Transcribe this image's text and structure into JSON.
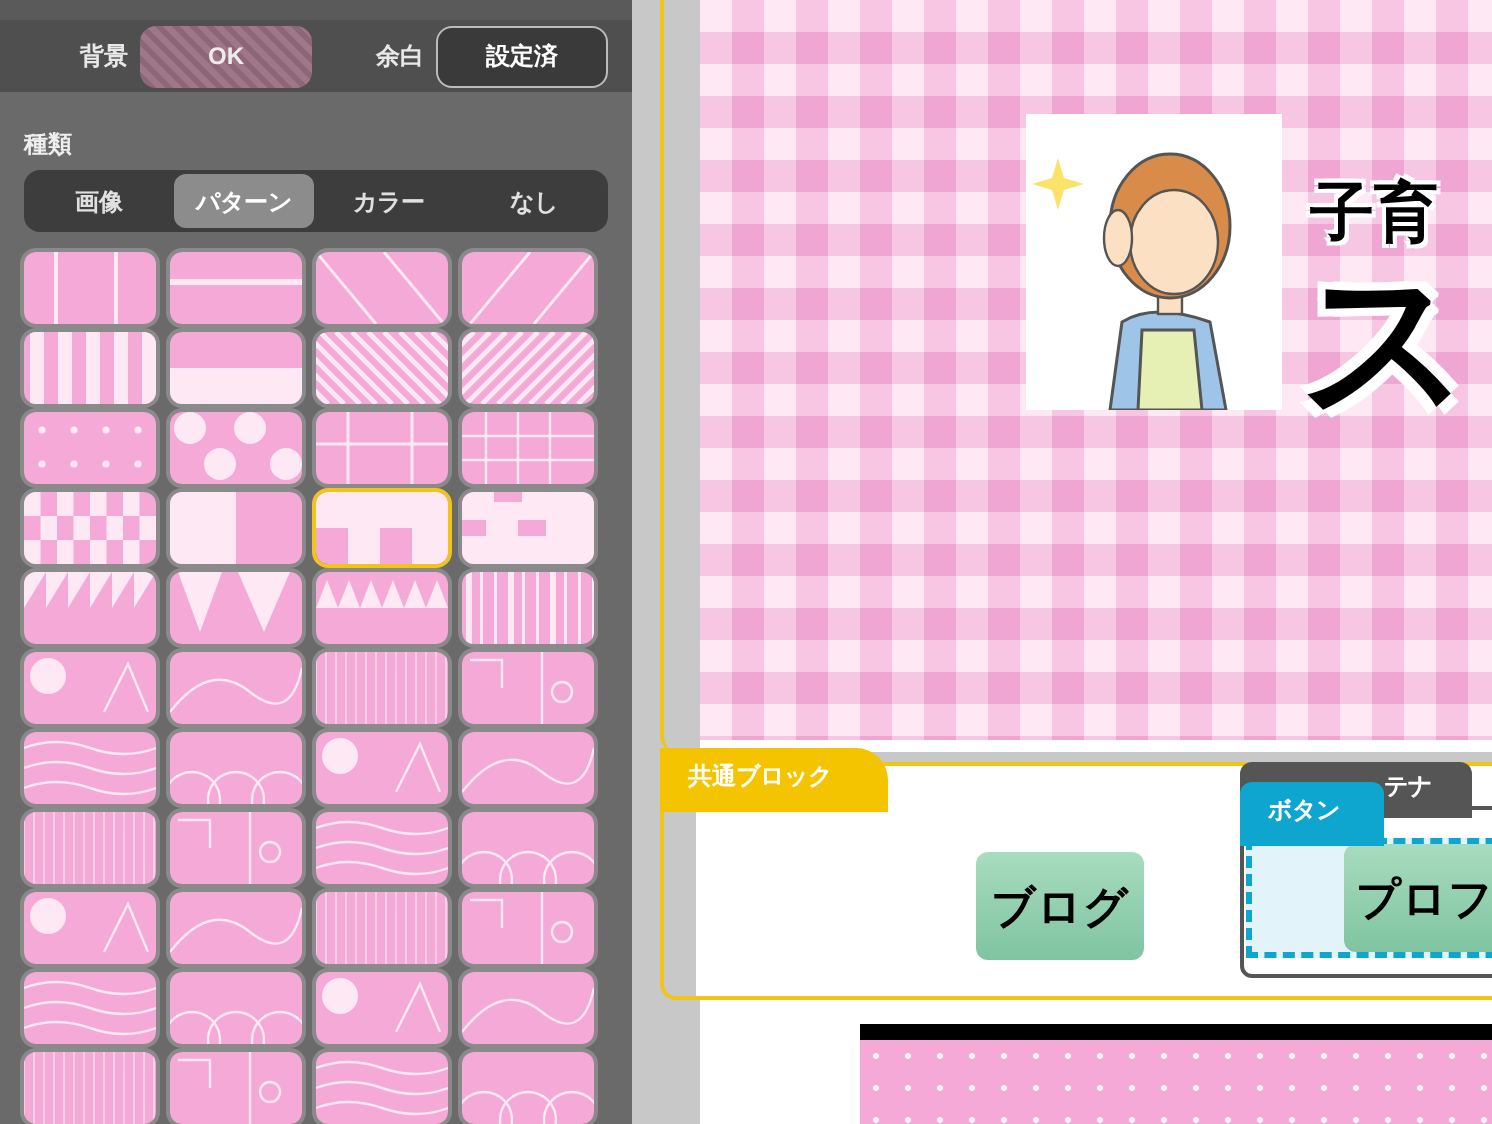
{
  "panel": {
    "background_label": "背景",
    "background_button": "OK",
    "margin_label": "余白",
    "margin_button": "設定済",
    "type_label": "種類",
    "type_tabs": [
      {
        "label": "画像",
        "selected": false
      },
      {
        "label": "パターン",
        "selected": true
      },
      {
        "label": "カラー",
        "selected": false
      },
      {
        "label": "なし",
        "selected": false
      }
    ],
    "patterns": [
      {
        "selected": false
      },
      {
        "selected": false
      },
      {
        "selected": false
      },
      {
        "selected": false
      },
      {
        "selected": false
      },
      {
        "selected": false
      },
      {
        "selected": false
      },
      {
        "selected": false
      },
      {
        "selected": false
      },
      {
        "selected": false
      },
      {
        "selected": false
      },
      {
        "selected": false
      },
      {
        "selected": false
      },
      {
        "selected": false
      },
      {
        "selected": true
      },
      {
        "selected": false
      },
      {
        "selected": false
      },
      {
        "selected": false
      },
      {
        "selected": false
      },
      {
        "selected": false
      },
      {
        "selected": false
      },
      {
        "selected": false
      },
      {
        "selected": false
      },
      {
        "selected": false
      },
      {
        "selected": false
      },
      {
        "selected": false
      },
      {
        "selected": false
      },
      {
        "selected": false
      },
      {
        "selected": false
      },
      {
        "selected": false
      },
      {
        "selected": false
      },
      {
        "selected": false
      },
      {
        "selected": false
      },
      {
        "selected": false
      },
      {
        "selected": false
      },
      {
        "selected": false
      },
      {
        "selected": false
      },
      {
        "selected": false
      },
      {
        "selected": false
      },
      {
        "selected": false
      },
      {
        "selected": false
      },
      {
        "selected": false
      },
      {
        "selected": false
      },
      {
        "selected": false
      }
    ]
  },
  "canvas": {
    "header": {
      "subtitle": "子育",
      "title": "ス"
    },
    "block": {
      "label": "共通ブロック",
      "button": "ブログ",
      "container_tab": "テナ",
      "button_tab": "ボタン",
      "button_2": "プロフ"
    }
  }
}
